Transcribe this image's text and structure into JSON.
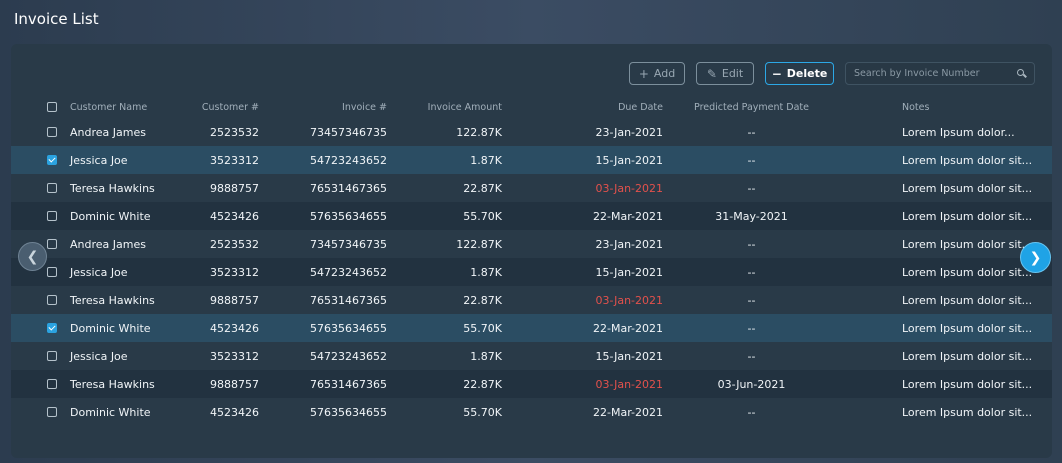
{
  "page": {
    "title": "Invoice List"
  },
  "toolbar": {
    "add_label": "Add",
    "add_icon": "+",
    "edit_label": "Edit",
    "edit_icon": "✎",
    "delete_label": "Delete",
    "delete_icon": "−",
    "search_placeholder": "Search by Invoice Number",
    "accent_color": "#2ca8e6"
  },
  "table": {
    "headers": {
      "customer_name": "Customer Name",
      "customer_no": "Customer #",
      "invoice_no": "Invoice #",
      "invoice_amount": "Invoice Amount",
      "due_date": "Due Date",
      "predicted_payment_date": "Predicted Payment Date",
      "notes": "Notes"
    },
    "rows": [
      {
        "name": "Andrea James",
        "customer": "2523532",
        "invoice": "73457346735",
        "amount": "122.87K",
        "due": "23-Jan-2021",
        "overdue": false,
        "predicted": "--",
        "notes": "Lorem Ipsum dolor...",
        "checked": false
      },
      {
        "name": "Jessica Joe",
        "customer": "3523312",
        "invoice": "54723243652",
        "amount": "1.87K",
        "due": "15-Jan-2021",
        "overdue": false,
        "predicted": "--",
        "notes": "Lorem Ipsum dolor sit...",
        "checked": true
      },
      {
        "name": "Teresa Hawkins",
        "customer": "9888757",
        "invoice": "76531467365",
        "amount": "22.87K",
        "due": "03-Jan-2021",
        "overdue": true,
        "predicted": "--",
        "notes": "Lorem Ipsum dolor sit...",
        "checked": false
      },
      {
        "name": "Dominic White",
        "customer": "4523426",
        "invoice": "57635634655",
        "amount": "55.70K",
        "due": "22-Mar-2021",
        "overdue": false,
        "predicted": "31-May-2021",
        "notes": "Lorem Ipsum dolor sit...",
        "checked": false
      },
      {
        "name": "Andrea James",
        "customer": "2523532",
        "invoice": "73457346735",
        "amount": "122.87K",
        "due": "23-Jan-2021",
        "overdue": false,
        "predicted": "--",
        "notes": "Lorem Ipsum dolor sit...",
        "checked": false
      },
      {
        "name": "Jessica Joe",
        "customer": "3523312",
        "invoice": "54723243652",
        "amount": "1.87K",
        "due": "15-Jan-2021",
        "overdue": false,
        "predicted": "--",
        "notes": "Lorem Ipsum dolor sit...",
        "checked": false
      },
      {
        "name": "Teresa Hawkins",
        "customer": "9888757",
        "invoice": "76531467365",
        "amount": "22.87K",
        "due": "03-Jan-2021",
        "overdue": true,
        "predicted": "--",
        "notes": "Lorem Ipsum dolor sit...",
        "checked": false
      },
      {
        "name": "Dominic White",
        "customer": "4523426",
        "invoice": "57635634655",
        "amount": "55.70K",
        "due": "22-Mar-2021",
        "overdue": false,
        "predicted": "--",
        "notes": "Lorem Ipsum dolor sit...",
        "checked": true
      },
      {
        "name": "Jessica Joe",
        "customer": "3523312",
        "invoice": "54723243652",
        "amount": "1.87K",
        "due": "15-Jan-2021",
        "overdue": false,
        "predicted": "--",
        "notes": "Lorem Ipsum dolor sit...",
        "checked": false
      },
      {
        "name": "Teresa Hawkins",
        "customer": "9888757",
        "invoice": "76531467365",
        "amount": "22.87K",
        "due": "03-Jan-2021",
        "overdue": true,
        "predicted": "03-Jun-2021",
        "notes": "Lorem Ipsum dolor sit...",
        "checked": false
      },
      {
        "name": "Dominic White",
        "customer": "4523426",
        "invoice": "57635634655",
        "amount": "55.70K",
        "due": "22-Mar-2021",
        "overdue": false,
        "predicted": "--",
        "notes": "Lorem Ipsum dolor sit...",
        "checked": false
      }
    ],
    "overdue_color": "#e2514c"
  },
  "pager": {
    "prev_icon": "chevron-left-icon",
    "next_icon": "chevron-right-icon"
  }
}
